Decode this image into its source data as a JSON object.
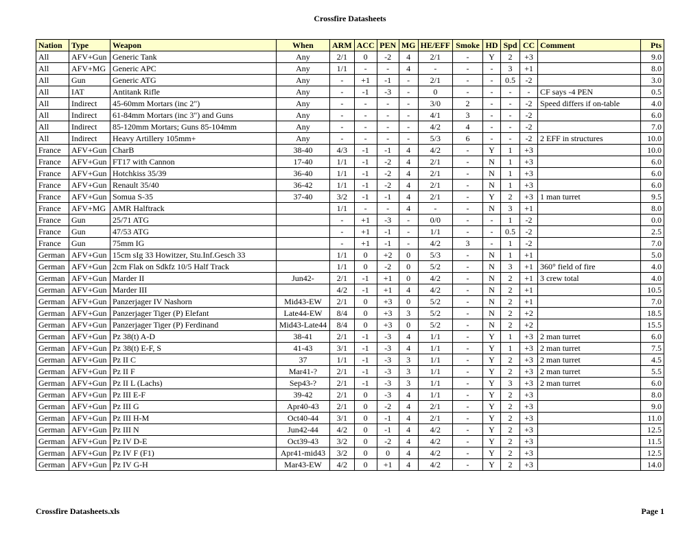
{
  "title": "Crossfire Datasheets",
  "footer_left": "Crossfire Datasheets.xls",
  "footer_right": "Page 1",
  "headers": [
    "Nation",
    "Type",
    "Weapon",
    "When",
    "ARM",
    "ACC",
    "PEN",
    "MG",
    "HE/EFF",
    "Smoke",
    "HD",
    "Spd",
    "CC",
    "Comment",
    "Pts"
  ],
  "rows": [
    [
      "All",
      "AFV+Gun",
      "Generic Tank",
      "Any",
      "2/1",
      "0",
      "-2",
      "4",
      "2/1",
      "-",
      "Y",
      "2",
      "+3",
      "",
      "9.0"
    ],
    [
      "All",
      "AFV+MG",
      "Generic APC",
      "Any",
      "1/1",
      "-",
      "-",
      "4",
      "-",
      "-",
      "-",
      "3",
      "+1",
      "",
      "8.0"
    ],
    [
      "All",
      "Gun",
      "Generic ATG",
      "Any",
      "-",
      "+1",
      "-1",
      "-",
      "2/1",
      "-",
      "-",
      "0.5",
      "-2",
      "",
      "3.0"
    ],
    [
      "All",
      "IAT",
      "Antitank Rifle",
      "Any",
      "-",
      "-1",
      "-3",
      "-",
      "0",
      "-",
      "-",
      "-",
      "-",
      "CF says -4 PEN",
      "0.5"
    ],
    [
      "All",
      "Indirect",
      "45-60mm Mortars (inc 2\")",
      "Any",
      "-",
      "-",
      "-",
      "-",
      "3/0",
      "2",
      "-",
      "-",
      "-2",
      "Speed differs if on-table",
      "4.0"
    ],
    [
      "All",
      "Indirect",
      "61-84mm Mortars (inc 3\") and Guns",
      "Any",
      "-",
      "-",
      "-",
      "-",
      "4/1",
      "3",
      "-",
      "-",
      "-2",
      "",
      "6.0"
    ],
    [
      "All",
      "Indirect",
      "85-120mm Mortars; Guns 85-104mm",
      "Any",
      "-",
      "-",
      "-",
      "-",
      "4/2",
      "4",
      "-",
      "-",
      "-2",
      "",
      "7.0"
    ],
    [
      "All",
      "Indirect",
      "Heavy Artillery 105mm+",
      "Any",
      "-",
      "-",
      "-",
      "-",
      "5/3",
      "6",
      "-",
      "-",
      "-2",
      "2 EFF in structures",
      "10.0"
    ],
    [
      "France",
      "AFV+Gun",
      "CharB",
      "38-40",
      "4/3",
      "-1",
      "-1",
      "4",
      "4/2",
      "-",
      "Y",
      "1",
      "+3",
      "",
      "10.0"
    ],
    [
      "France",
      "AFV+Gun",
      "FT17 with Cannon",
      "17-40",
      "1/1",
      "-1",
      "-2",
      "4",
      "2/1",
      "-",
      "N",
      "1",
      "+3",
      "",
      "6.0"
    ],
    [
      "France",
      "AFV+Gun",
      "Hotchkiss 35/39",
      "36-40",
      "1/1",
      "-1",
      "-2",
      "4",
      "2/1",
      "-",
      "N",
      "1",
      "+3",
      "",
      "6.0"
    ],
    [
      "France",
      "AFV+Gun",
      "Renault 35/40",
      "36-42",
      "1/1",
      "-1",
      "-2",
      "4",
      "2/1",
      "-",
      "N",
      "1",
      "+3",
      "",
      "6.0"
    ],
    [
      "France",
      "AFV+Gun",
      "Somua S-35",
      "37-40",
      "3/2",
      "-1",
      "-1",
      "4",
      "2/1",
      "-",
      "Y",
      "2",
      "+3",
      "1 man turret",
      "9.5"
    ],
    [
      "France",
      "AFV+MG",
      "AMR Halftrack",
      "",
      "1/1",
      "-",
      "-",
      "4",
      "-",
      "-",
      "N",
      "3",
      "+1",
      "",
      "8.0"
    ],
    [
      "France",
      "Gun",
      "25/71 ATG",
      "",
      "-",
      "+1",
      "-3",
      "-",
      "0/0",
      "-",
      "-",
      "1",
      "-2",
      "",
      "0.0"
    ],
    [
      "France",
      "Gun",
      "47/53 ATG",
      "",
      "-",
      "+1",
      "-1",
      "-",
      "1/1",
      "-",
      "-",
      "0.5",
      "-2",
      "",
      "2.5"
    ],
    [
      "France",
      "Gun",
      "75mm IG",
      "",
      "-",
      "+1",
      "-1",
      "-",
      "4/2",
      "3",
      "-",
      "1",
      "-2",
      "",
      "7.0"
    ],
    [
      "German",
      "AFV+Gun",
      "15cm sIg 33 Howitzer, Stu.Inf.Gesch 33",
      "",
      "1/1",
      "0",
      "+2",
      "0",
      "5/3",
      "-",
      "N",
      "1",
      "+1",
      "",
      "5.0"
    ],
    [
      "German",
      "AFV+Gun",
      "2cm Flak on Sdkfz 10/5 Half Track",
      "",
      "1/1",
      "0",
      "-2",
      "0",
      "5/2",
      "-",
      "N",
      "3",
      "+1",
      "360° field of fire",
      "4.0"
    ],
    [
      "German",
      "AFV+Gun",
      "Marder II",
      "Jun42-",
      "2/1",
      "-1",
      "+1",
      "0",
      "4/2",
      "-",
      "N",
      "2",
      "+1",
      "3 crew total",
      "4.0"
    ],
    [
      "German",
      "AFV+Gun",
      "Marder III",
      "",
      "4/2",
      "-1",
      "+1",
      "4",
      "4/2",
      "-",
      "N",
      "2",
      "+1",
      "",
      "10.5"
    ],
    [
      "German",
      "AFV+Gun",
      "Panzerjager IV Nashorn",
      "Mid43-EW",
      "2/1",
      "0",
      "+3",
      "0",
      "5/2",
      "-",
      "N",
      "2",
      "+1",
      "",
      "7.0"
    ],
    [
      "German",
      "AFV+Gun",
      "Panzerjager Tiger (P) Elefant",
      "Late44-EW",
      "8/4",
      "0",
      "+3",
      "3",
      "5/2",
      "-",
      "N",
      "2",
      "+2",
      "",
      "18.5"
    ],
    [
      "German",
      "AFV+Gun",
      "Panzerjager Tiger (P) Ferdinand",
      "Mid43-Late44",
      "8/4",
      "0",
      "+3",
      "0",
      "5/2",
      "-",
      "N",
      "2",
      "+2",
      "",
      "15.5"
    ],
    [
      "German",
      "AFV+Gun",
      "Pz 38(t) A-D",
      "38-41",
      "2/1",
      "-1",
      "-3",
      "4",
      "1/1",
      "-",
      "Y",
      "1",
      "+3",
      "2 man turret",
      "6.0"
    ],
    [
      "German",
      "AFV+Gun",
      "Pz 38(t) E-F, S",
      "41-43",
      "3/1",
      "-1",
      "-3",
      "4",
      "1/1",
      "-",
      "Y",
      "1",
      "+3",
      "2 man turret",
      "7.5"
    ],
    [
      "German",
      "AFV+Gun",
      "Pz II C",
      "37",
      "1/1",
      "-1",
      "-3",
      "3",
      "1/1",
      "-",
      "Y",
      "2",
      "+3",
      "2 man turret",
      "4.5"
    ],
    [
      "German",
      "AFV+Gun",
      "Pz II F",
      "Mar41-?",
      "2/1",
      "-1",
      "-3",
      "3",
      "1/1",
      "-",
      "Y",
      "2",
      "+3",
      "2 man turret",
      "5.5"
    ],
    [
      "German",
      "AFV+Gun",
      "Pz II L (Lachs)",
      "Sep43-?",
      "2/1",
      "-1",
      "-3",
      "3",
      "1/1",
      "-",
      "Y",
      "3",
      "+3",
      "2 man turret",
      "6.0"
    ],
    [
      "German",
      "AFV+Gun",
      "Pz III E-F",
      "39-42",
      "2/1",
      "0",
      "-3",
      "4",
      "1/1",
      "-",
      "Y",
      "2",
      "+3",
      "",
      "8.0"
    ],
    [
      "German",
      "AFV+Gun",
      "Pz III G",
      "Apr40-43",
      "2/1",
      "0",
      "-2",
      "4",
      "2/1",
      "-",
      "Y",
      "2",
      "+3",
      "",
      "9.0"
    ],
    [
      "German",
      "AFV+Gun",
      "Pz III H-M",
      "Oct40-44",
      "3/1",
      "0",
      "-1",
      "4",
      "2/1",
      "-",
      "Y",
      "2",
      "+3",
      "",
      "11.0"
    ],
    [
      "German",
      "AFV+Gun",
      "Pz III N",
      "Jun42-44",
      "4/2",
      "0",
      "-1",
      "4",
      "4/2",
      "-",
      "Y",
      "2",
      "+3",
      "",
      "12.5"
    ],
    [
      "German",
      "AFV+Gun",
      "Pz IV D-E",
      "Oct39-43",
      "3/2",
      "0",
      "-2",
      "4",
      "4/2",
      "-",
      "Y",
      "2",
      "+3",
      "",
      "11.5"
    ],
    [
      "German",
      "AFV+Gun",
      "Pz IV F (F1)",
      "Apr41-mid43",
      "3/2",
      "0",
      "0",
      "4",
      "4/2",
      "-",
      "Y",
      "2",
      "+3",
      "",
      "12.5"
    ],
    [
      "German",
      "AFV+Gun",
      "Pz IV G-H",
      "Mar43-EW",
      "4/2",
      "0",
      "+1",
      "4",
      "4/2",
      "-",
      "Y",
      "2",
      "+3",
      "",
      "14.0"
    ]
  ]
}
